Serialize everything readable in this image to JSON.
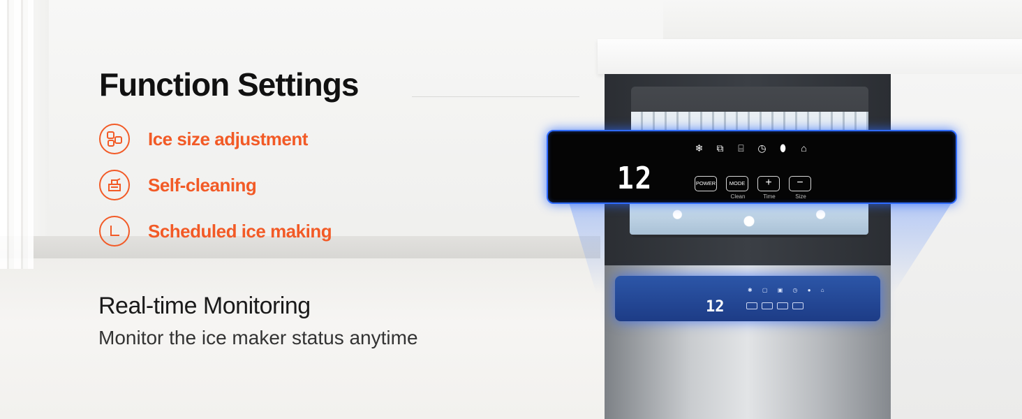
{
  "title": "Function Settings",
  "features": [
    {
      "icon": "ice-size-icon",
      "label": "Ice size adjustment"
    },
    {
      "icon": "self-cleaning-icon",
      "label": "Self-cleaning"
    },
    {
      "icon": "timer-icon",
      "label": "Scheduled ice making"
    }
  ],
  "monitoring": {
    "heading": "Real-time Monitoring",
    "description": "Monitor the ice maker status anytime"
  },
  "panel": {
    "display": "12",
    "buttons": [
      {
        "label": "POWER",
        "caption": ""
      },
      {
        "label": "MODE",
        "caption": "Clean"
      },
      {
        "label": "+",
        "caption": "Time"
      },
      {
        "label": "−",
        "caption": "Size"
      }
    ],
    "status_icons": [
      "snowflake-icon",
      "ice-size-icon",
      "cleaning-icon",
      "clock-icon",
      "water-icon",
      "bin-full-icon"
    ]
  },
  "colors": {
    "accent": "#f25a26",
    "panel_glow": "#2f6bff"
  }
}
